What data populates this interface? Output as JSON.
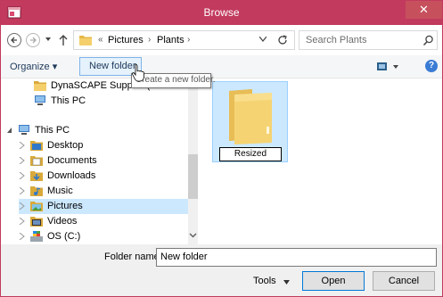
{
  "window": {
    "title": "Browse",
    "accent_color": "#c23a5e",
    "close_label": "✕"
  },
  "navigation": {
    "back_icon": "back-arrow-icon",
    "forward_icon": "forward-arrow-icon",
    "up_icon": "up-arrow-icon",
    "address": {
      "overflow": "«",
      "crumbs": [
        "Pictures",
        "Plants"
      ],
      "separator": "›"
    },
    "search_placeholder": "Search Plants"
  },
  "commandbar": {
    "organize_label": "Organize ▾",
    "new_folder_label": "New folder",
    "tooltip": "Create a new folder."
  },
  "navpane": {
    "items": [
      {
        "label": "DynaSCAPE Support (",
        "icon": "folder-icon"
      },
      {
        "label": "This PC",
        "icon": "computer-icon"
      },
      {
        "label": "This PC",
        "icon": "computer-icon"
      },
      {
        "label": "Desktop",
        "icon": "desktop-folder-icon"
      },
      {
        "label": "Documents",
        "icon": "documents-folder-icon"
      },
      {
        "label": "Downloads",
        "icon": "downloads-folder-icon"
      },
      {
        "label": "Music",
        "icon": "music-folder-icon"
      },
      {
        "label": "Pictures",
        "icon": "pictures-folder-icon"
      },
      {
        "label": "Videos",
        "icon": "videos-folder-icon"
      },
      {
        "label": "OS (C:)",
        "icon": "drive-icon"
      }
    ],
    "selected": "Pictures"
  },
  "content": {
    "folder_name_editing": "Resized"
  },
  "footer": {
    "folder_name_label": "Folder name:",
    "folder_name_value": "New folder",
    "tools_label": "Tools",
    "open_label": "Open",
    "cancel_label": "Cancel"
  }
}
